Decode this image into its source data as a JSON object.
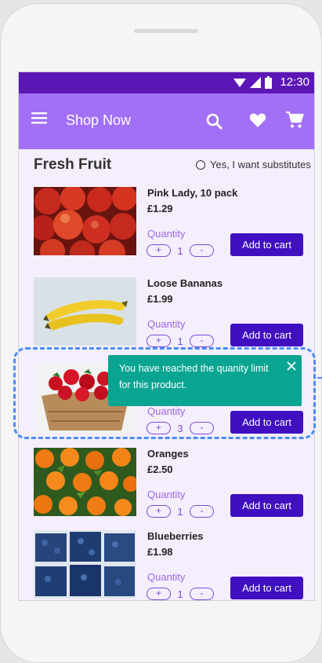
{
  "status": {
    "time": "12:30"
  },
  "appbar": {
    "title": "Shop Now"
  },
  "section": {
    "title": "Fresh Fruit",
    "substitutes_label": "Yes, I want substitutes"
  },
  "products": [
    {
      "name": "Pink Lady, 10 pack",
      "price": "£1.29",
      "quantity_label": "Quantity",
      "quantity": "1",
      "add_label": "Add to cart"
    },
    {
      "name": "Loose Bananas",
      "price": "£1.99",
      "quantity_label": "Quantity",
      "quantity": "1",
      "add_label": "Add to cart"
    },
    {
      "name": "",
      "price": "",
      "quantity_label": "Quantity",
      "quantity": "3",
      "add_label": "Add to cart"
    },
    {
      "name": "Oranges",
      "price": "£2.50",
      "quantity_label": "Quantity",
      "quantity": "1",
      "add_label": "Add to cart"
    },
    {
      "name": "Blueberries",
      "price": "£1.98",
      "quantity_label": "Quantity",
      "quantity": "1",
      "add_label": "Add to cart"
    }
  ],
  "stepper": {
    "plus": "+",
    "minus": "-"
  },
  "snackbar": {
    "message": "You have reached the quanity limit for this product."
  },
  "colors": {
    "statusbar": "#5d16b6",
    "appbar": "#a270f6",
    "button": "#3f0fc0",
    "snackbar": "#0aa592",
    "highlight": "#4b8df5"
  }
}
